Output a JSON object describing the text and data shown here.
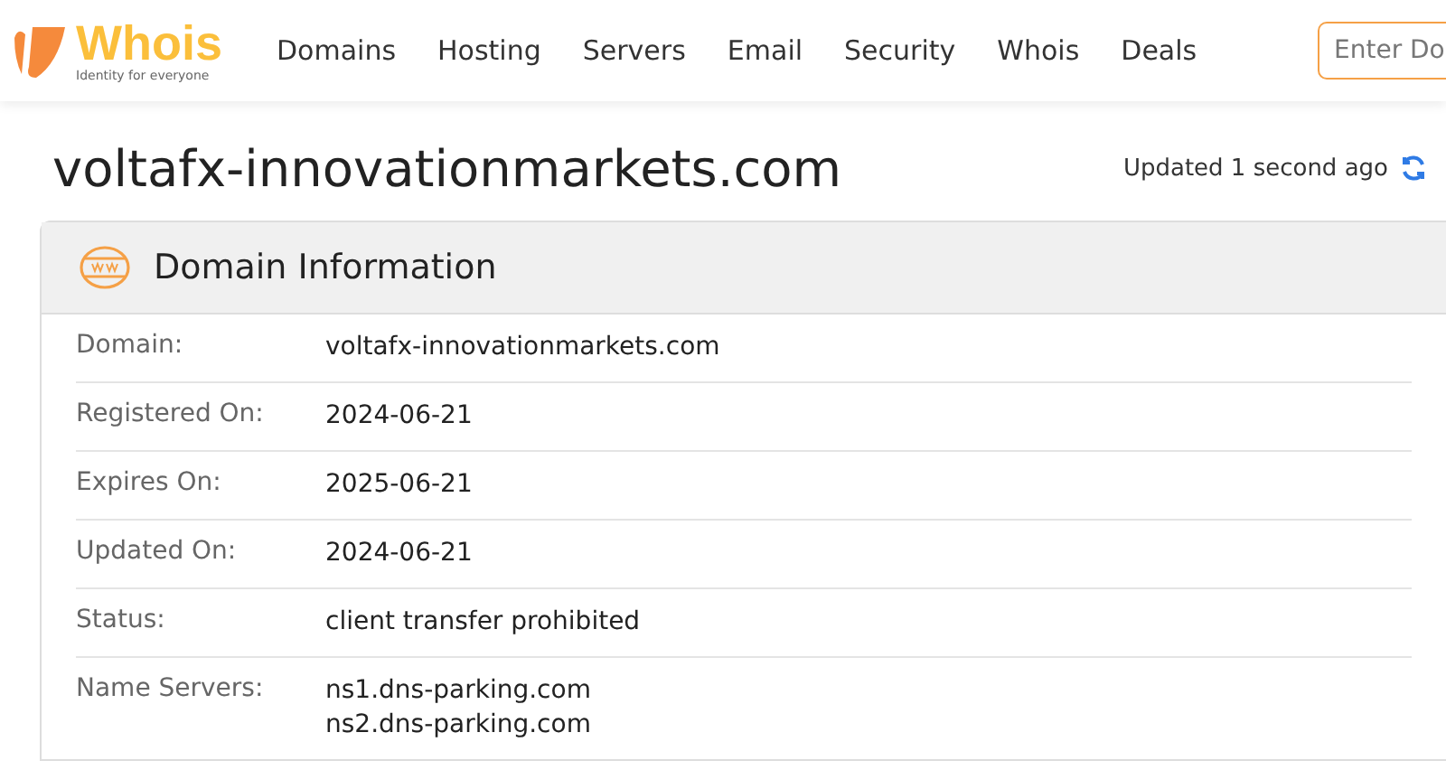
{
  "logo": {
    "name": "Whois",
    "tagline": "Identity for everyone"
  },
  "nav": [
    "Domains",
    "Hosting",
    "Servers",
    "Email",
    "Security",
    "Whois",
    "Deals"
  ],
  "search": {
    "placeholder": "Enter Do"
  },
  "page_title": "voltafx-innovationmarkets.com",
  "updated": "Updated 1 second ago",
  "card": {
    "title": "Domain Information",
    "rows": [
      {
        "label": "Domain:",
        "values": [
          "voltafx-innovationmarkets.com"
        ]
      },
      {
        "label": "Registered On:",
        "values": [
          "2024-06-21"
        ]
      },
      {
        "label": "Expires On:",
        "values": [
          "2025-06-21"
        ]
      },
      {
        "label": "Updated On:",
        "values": [
          "2024-06-21"
        ]
      },
      {
        "label": "Status:",
        "values": [
          "client transfer prohibited"
        ]
      },
      {
        "label": "Name Servers:",
        "values": [
          "ns1.dns-parking.com",
          "ns2.dns-parking.com"
        ]
      }
    ]
  }
}
